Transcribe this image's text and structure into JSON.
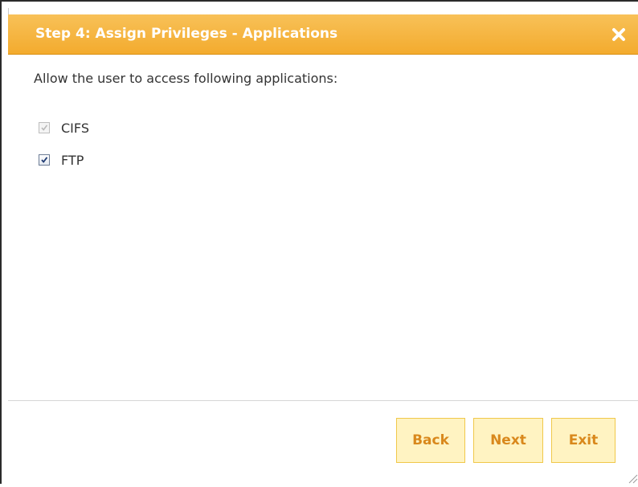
{
  "dialog": {
    "title": "Step 4: Assign Privileges - Applications",
    "close_icon": "close-x-icon"
  },
  "content": {
    "prompt": "Allow the user to access following applications:",
    "applications": [
      {
        "label": "CIFS",
        "checked": true,
        "disabled": true
      },
      {
        "label": "FTP",
        "checked": true,
        "disabled": false
      }
    ]
  },
  "footer": {
    "back_label": "Back",
    "next_label": "Next",
    "exit_label": "Exit"
  },
  "colors": {
    "titlebar": "#f3ab2e",
    "button_bg": "#fff3c2",
    "button_border": "#f0c84a",
    "button_text": "#d9881c"
  }
}
